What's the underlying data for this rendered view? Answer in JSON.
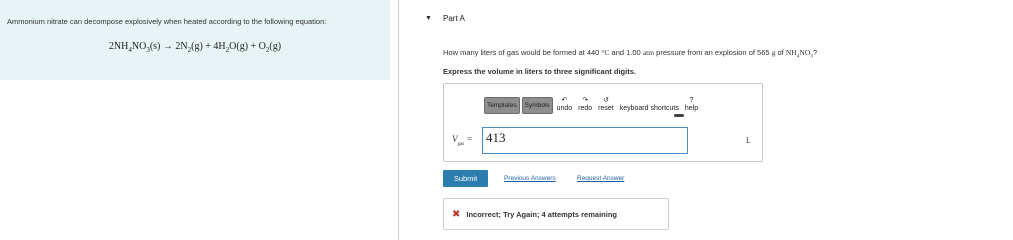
{
  "problem": {
    "intro": "Ammonium nitrate can decompose explosively when heated according to the following equation:",
    "equation_parts": {
      "r1": "2NH",
      "r1s1": "4",
      "r1b": "NO",
      "r1s2": "3",
      "r1c": "(s) → 2N",
      "p1s": "2",
      "p1b": "(g) + 4H",
      "p2s": "2",
      "p2b": "O(g) + O",
      "p3s": "2",
      "p3b": "(g)"
    }
  },
  "part": {
    "caret": "▼",
    "title": "Part A"
  },
  "question": {
    "t1": "How many liters of gas would be formed at 440 ",
    "deg": "°C",
    "t2": " and 1.00 ",
    "atm": "atm",
    "t3": " pressure from an explosion of 565 ",
    "g": "g",
    "t4": " of ",
    "f1": "NH",
    "f1s": "4",
    "f2": "NO",
    "f2s": "3",
    "t5": "?"
  },
  "instruction": "Express the volume in liters to three significant digits.",
  "toolbar": {
    "templates": "Templates",
    "symbols": "Symbols",
    "undo": "undo",
    "undo_glyph": "↶",
    "redo": "redo",
    "redo_glyph": "↷",
    "reset": "reset",
    "reset_glyph": "↺",
    "keyboard": "keyboard shortcuts",
    "help": "help",
    "help_glyph": "?"
  },
  "answer": {
    "var": "V",
    "var_sub": "gas",
    "eq": " = ",
    "value": "413",
    "unit": "L"
  },
  "actions": {
    "submit": "Submit",
    "previous": "Previous Answers",
    "request": "Request Answer"
  },
  "feedback": {
    "icon": "✖",
    "text": "Incorrect; Try Again; 4 attempts remaining"
  },
  "colors": {
    "panel_bg": "#e7f3f4",
    "submit_bg": "#2b7db0",
    "link": "#1f5e9e",
    "error": "#c0392b",
    "input_border": "#4a90c8"
  }
}
